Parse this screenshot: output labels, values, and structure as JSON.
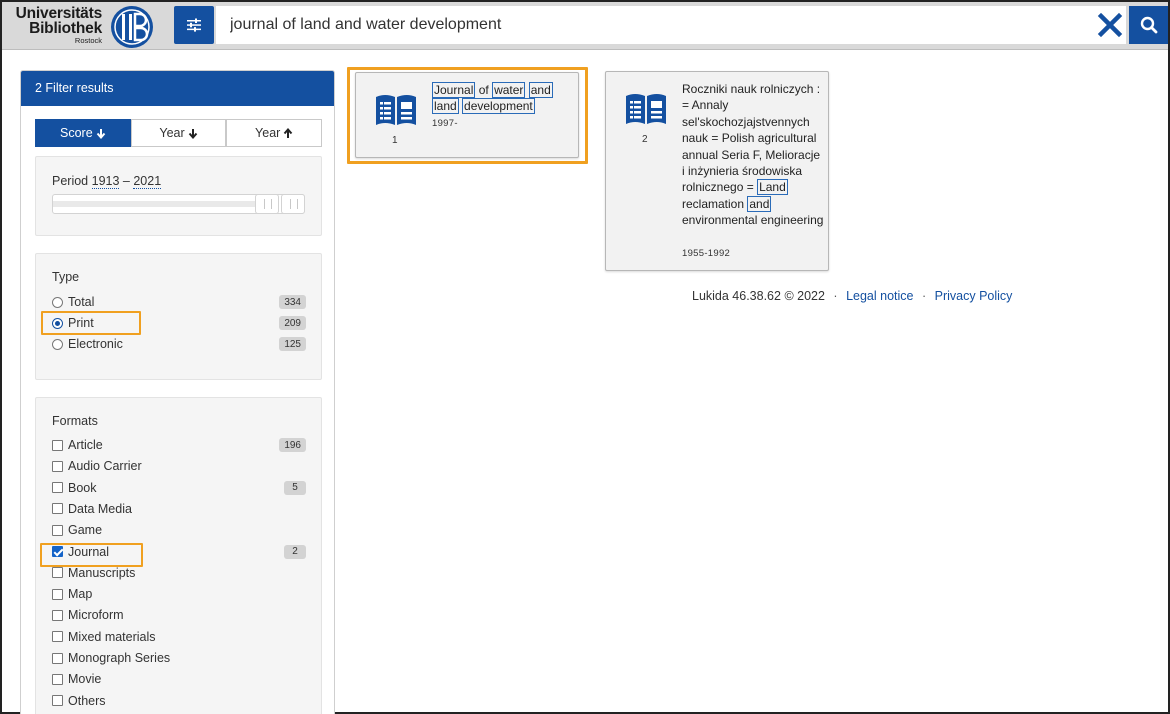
{
  "header": {
    "logo_line1": "Universitäts",
    "logo_line2": "Bibliothek",
    "logo_line3": "Rostock",
    "search_value": "journal of land and water development",
    "accent_color": "#1450a0"
  },
  "sidebar": {
    "title": "2 Filter results",
    "sort_options": [
      {
        "label": "Score",
        "icon": "arrow-down-icon",
        "active": true
      },
      {
        "label": "Year",
        "icon": "arrow-down-icon",
        "active": false
      },
      {
        "label": "Year",
        "icon": "arrow-up-icon",
        "active": false
      }
    ],
    "period": {
      "label": "Period",
      "from": "1913",
      "sep": "–",
      "to": "2021"
    },
    "type": {
      "title": "Type",
      "options": [
        {
          "label": "Total",
          "count": "334",
          "selected": false
        },
        {
          "label": "Print",
          "count": "209",
          "selected": true
        },
        {
          "label": "Electronic",
          "count": "125",
          "selected": false
        }
      ]
    },
    "formats": {
      "title": "Formats",
      "options": [
        {
          "label": "Article",
          "count": "196",
          "checked": false
        },
        {
          "label": "Audio Carrier",
          "count": "",
          "checked": false
        },
        {
          "label": "Book",
          "count": "5",
          "checked": false
        },
        {
          "label": "Data Media",
          "count": "",
          "checked": false
        },
        {
          "label": "Game",
          "count": "",
          "checked": false
        },
        {
          "label": "Journal",
          "count": "2",
          "checked": true
        },
        {
          "label": "Manuscripts",
          "count": "",
          "checked": false
        },
        {
          "label": "Map",
          "count": "",
          "checked": false
        },
        {
          "label": "Microform",
          "count": "",
          "checked": false
        },
        {
          "label": "Mixed materials",
          "count": "",
          "checked": false
        },
        {
          "label": "Monograph Series",
          "count": "",
          "checked": false
        },
        {
          "label": "Movie",
          "count": "",
          "checked": false
        },
        {
          "label": "Others",
          "count": "",
          "checked": false
        }
      ]
    }
  },
  "results": [
    {
      "index": "1",
      "icon": "open-book-icon",
      "title_words": [
        {
          "text": "Journal",
          "hl": true
        },
        {
          "text": "of",
          "hl": false
        },
        {
          "text": "water",
          "hl": true
        },
        {
          "text": "and",
          "hl": true
        },
        {
          "text": "land",
          "hl": true
        },
        {
          "text": "development",
          "hl": true
        }
      ],
      "date": "1997-"
    },
    {
      "index": "2",
      "icon": "open-book-icon",
      "title_words": [
        {
          "text": "Roczniki nauk rolniczych : = Annaly sel'skochozjajstvennych nauk = Polish agricultural annual Seria F, Melioracje i inżynieria środowiska rolnicznego =",
          "hl": false
        },
        {
          "text": "Land",
          "hl": true
        },
        {
          "text": "reclamation",
          "hl": false
        },
        {
          "text": "and",
          "hl": true
        },
        {
          "text": "environmental engineering",
          "hl": false
        }
      ],
      "date": "1955-1992"
    }
  ],
  "footer": {
    "version": "Lukida 46.38.62 © 2022",
    "separator": "·",
    "legal_notice": "Legal notice",
    "privacy_policy": "Privacy Policy"
  }
}
